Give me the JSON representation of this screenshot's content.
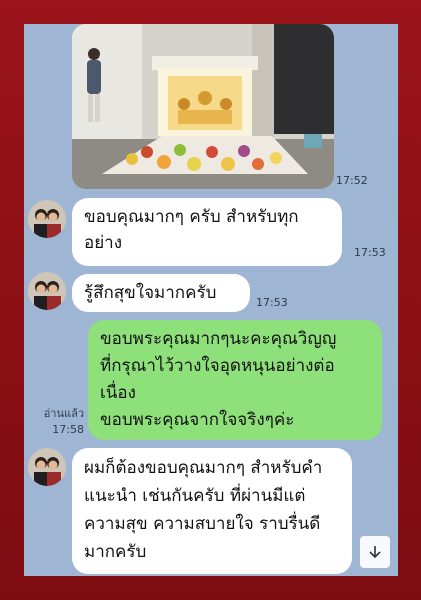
{
  "messages": {
    "photo_time": "17:52",
    "m1": {
      "text": "ขอบคุณมากๆ ครับ สำหรับทุกอย่าง",
      "time": "17:53"
    },
    "m2": {
      "text": "รู้สึกสุขใจมากครับ",
      "time": "17:53"
    },
    "m3": {
      "line1": "ขอบพระคุณมากๆนะคะคุณวิญญู",
      "line2": "ที่กรุณาไว้วางใจอุดหนุนอย่างต่อ",
      "line3": "เนื่อง",
      "line4": "ขอบพระคุณจากใจจริงๆค่ะ",
      "read": "อ่านแล้ว",
      "time": "17:58"
    },
    "m4": {
      "text": "ผมก็ต้องขอบคุณมากๆ สำหรับคำแนะนำ เช่นกันครับ ที่ผ่านมีแต่ความสุข ความสบายใจ ราบรื่นดีมากครับ"
    }
  },
  "colors": {
    "frame": "#8e1016",
    "chat_bg": "#9eb6d3",
    "incoming": "#ffffff",
    "outgoing": "#8ee07a"
  },
  "icons": [
    "share-icon",
    "scroll-down-icon"
  ]
}
